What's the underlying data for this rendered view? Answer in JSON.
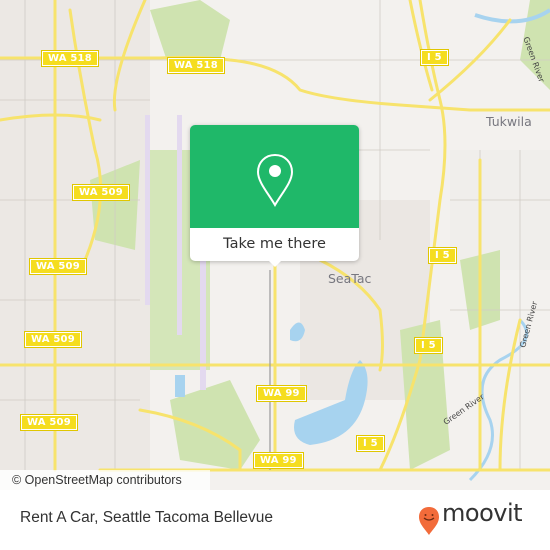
{
  "map": {
    "shields": [
      {
        "label": "WA 518",
        "id": "wa518-west"
      },
      {
        "label": "WA 518",
        "id": "wa518-east"
      },
      {
        "label": "I 5",
        "id": "i5-north"
      },
      {
        "label": "WA 509",
        "id": "wa509-upper"
      },
      {
        "label": "WA 509",
        "id": "wa509-middle"
      },
      {
        "label": "WA 509",
        "id": "wa509-lower"
      },
      {
        "label": "WA 509",
        "id": "wa509-bottom"
      },
      {
        "label": "I 5",
        "id": "i5-mid"
      },
      {
        "label": "I 5",
        "id": "i5-lower"
      },
      {
        "label": "WA 99",
        "id": "wa99-upper"
      },
      {
        "label": "WA 99",
        "id": "wa99-lower"
      },
      {
        "label": "I 5",
        "id": "i5-south"
      }
    ],
    "cities": [
      "Tukwila",
      "SeaTac"
    ],
    "rivers": [
      "Green River",
      "Green River",
      "Green River"
    ],
    "attribution": "© OpenStreetMap contributors"
  },
  "popup": {
    "icon": "location-pin-icon",
    "button_label": "Take me there",
    "color": "#1fb869"
  },
  "footer": {
    "place_name": "Rent A Car, Seattle Tacoma Bellevue",
    "brand": "moovit",
    "brand_color": "#f26b3a"
  }
}
